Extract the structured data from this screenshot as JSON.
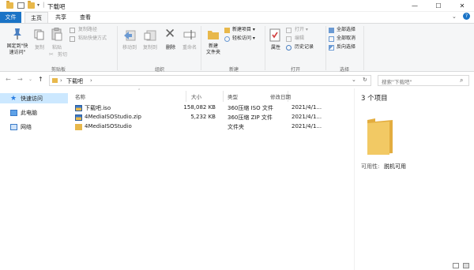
{
  "window": {
    "title": "下载吧",
    "controls": {
      "minimize": "—",
      "maximize": "☐",
      "close": "✕"
    }
  },
  "ribbon_tabs": [
    "文件",
    "主页",
    "共享",
    "查看"
  ],
  "ribbon": {
    "clipboard": {
      "pin_label_1": "固定到\"快",
      "pin_label_2": "速访问\"",
      "copy": "复制",
      "paste": "粘贴",
      "copy_path": "复制路径",
      "paste_shortcut": "粘贴快捷方式",
      "cut": "剪切",
      "group": "剪贴板"
    },
    "organize": {
      "move_to": "移动到",
      "copy_to": "复制到",
      "delete": "删除",
      "rename": "重命名",
      "group": "组织"
    },
    "new": {
      "new_folder_1": "新建",
      "new_folder_2": "文件夹",
      "new_item": "新建项目 ▾",
      "easy_access": "轻松访问 ▾",
      "group": "新建"
    },
    "open": {
      "properties": "属性",
      "open": "打开 ▾",
      "edit": "编辑",
      "history": "历史记录",
      "group": "打开"
    },
    "select": {
      "select_all": "全部选择",
      "select_none": "全部取消",
      "invert": "反向选择",
      "group": "选择"
    }
  },
  "address": {
    "back": "←",
    "forward": "→",
    "recent": "⌄",
    "up": "↑",
    "path": "下载吧",
    "path_sep": "›",
    "dropdown": "⌄",
    "refresh": "↻",
    "search_placeholder": "搜索\"下载吧\""
  },
  "nav": [
    {
      "label": "快速访问",
      "icon": "star-icon",
      "selected": true
    },
    {
      "label": "此电脑",
      "icon": "computer-icon",
      "selected": false
    },
    {
      "label": "网络",
      "icon": "network-icon",
      "selected": false
    }
  ],
  "columns": [
    "名称",
    "大小",
    "类型",
    "修改日期"
  ],
  "files": [
    {
      "name": "下载吧.iso",
      "size": "158,082 KB",
      "type": "360压缩 ISO 文件",
      "date": "2021/4/1...",
      "icon": "archive-icon"
    },
    {
      "name": "4MediaISOStudio.zip",
      "size": "5,232 KB",
      "type": "360压缩 ZIP 文件",
      "date": "2021/4/1...",
      "icon": "archive-icon"
    },
    {
      "name": "4MediaISOStudio",
      "size": "",
      "type": "文件夹",
      "date": "2021/4/1...",
      "icon": "folder-icon"
    }
  ],
  "preview": {
    "count": "3 个项目",
    "availability_label": "可用性:",
    "availability_value": "脱机可用"
  },
  "colors": {
    "accent": "#1a73c6",
    "folder": "#e8b84b",
    "selected_nav": "#cce8ff"
  }
}
